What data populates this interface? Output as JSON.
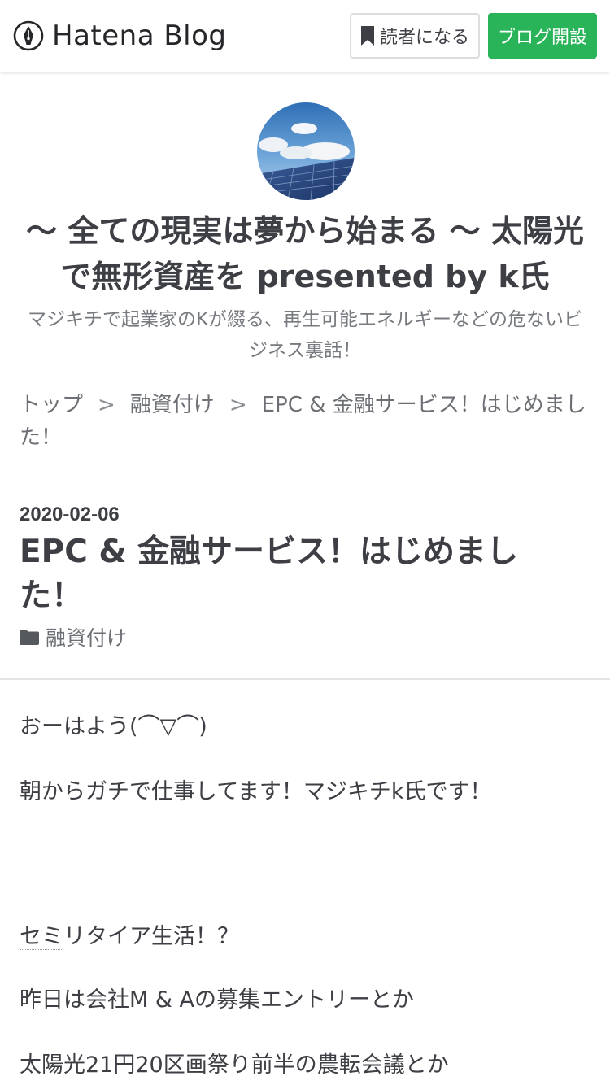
{
  "header": {
    "logo_text": "Hatena Blog",
    "subscribe_label": "読者になる",
    "create_blog_label": "ブログ開設"
  },
  "blog": {
    "title": "〜 全ての現実は夢から始まる 〜 太陽光で無形資産を presented by k氏",
    "description": "マジキチで起業家のKが綴る、再生可能エネルギーなどの危ないビジネス裏話！"
  },
  "breadcrumb": {
    "items": [
      "トップ",
      "融資付け",
      "EPC & 金融サービス！はじめました！"
    ],
    "separator": ">"
  },
  "entry": {
    "date": "2020-02-06",
    "title": "EPC & 金融サービス！はじめました！",
    "category": "融資付け",
    "body": {
      "p1": "おーはよう(⌒▽⌒)",
      "p2": "朝からガチで仕事してます！マジキチk氏です！",
      "p3_keyword": "セミ",
      "p3_rest": "リタイア生活！？",
      "p4": "昨日は会社M & Aの募集エントリーとか",
      "p5": "太陽光21円20区画祭り前半の農転会議とか"
    }
  },
  "colors": {
    "create_button": "#29b45a",
    "text": "#3d3f44",
    "muted_text": "#777b80",
    "divider": "#e2e4e8"
  },
  "icons": {
    "logo": "hatena-pen-icon",
    "subscribe": "bookmark-icon",
    "category": "folder-icon"
  }
}
